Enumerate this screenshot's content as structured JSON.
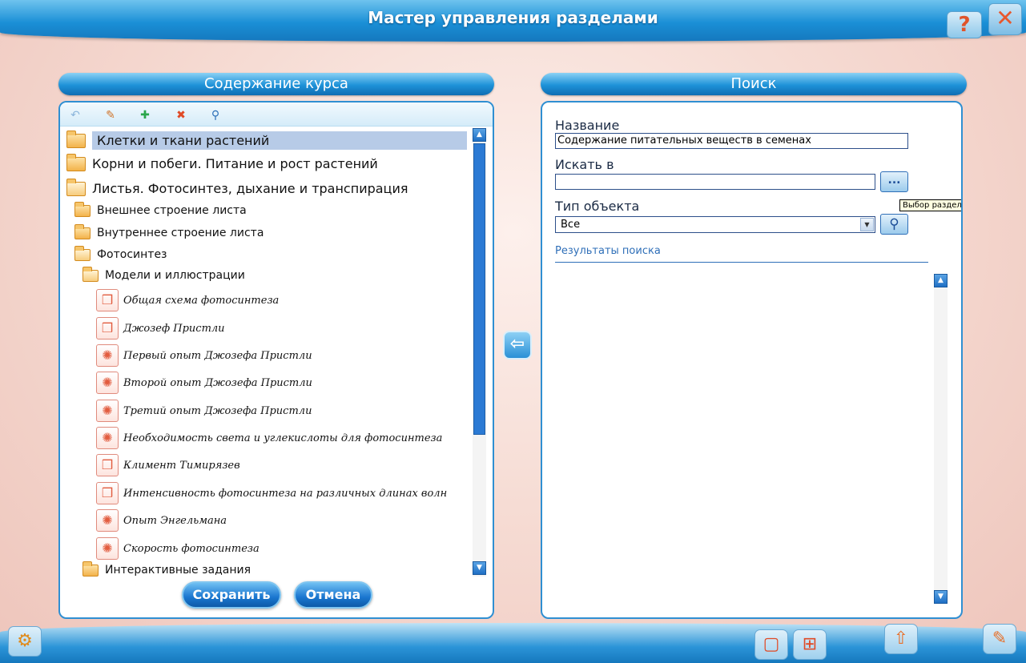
{
  "window": {
    "title": "Мастер управления разделами"
  },
  "left_panel": {
    "heading": "Содержание курса",
    "tree": [
      {
        "label": "Клетки и ткани растений",
        "kind": "folder"
      },
      {
        "label": "Корни и побеги. Питание и рост растений",
        "kind": "folder"
      },
      {
        "label": "Листья. Фотосинтез, дыхание и транспирация",
        "kind": "folder-open"
      },
      {
        "label": "Внешнее строение листа",
        "kind": "folder"
      },
      {
        "label": "Внутреннее строение листа",
        "kind": "folder"
      },
      {
        "label": "Фотосинтез",
        "kind": "folder-open"
      },
      {
        "label": "Модели и иллюстрации",
        "kind": "folder-open"
      },
      {
        "label": "Общая схема фотосинтеза",
        "kind": "model"
      },
      {
        "label": "Джозеф Пристли",
        "kind": "model"
      },
      {
        "label": "Первый опыт Джозефа Пристли",
        "kind": "illustration"
      },
      {
        "label": "Второй опыт Джозефа Пристли",
        "kind": "illustration"
      },
      {
        "label": "Третий опыт Джозефа Пристли",
        "kind": "illustration"
      },
      {
        "label": "Необходимость света и углекислоты для фотосинтеза",
        "kind": "illustration"
      },
      {
        "label": "Климент Тимирязев",
        "kind": "model"
      },
      {
        "label": "Интенсивность фотосинтеза на различных длинах волн",
        "kind": "model"
      },
      {
        "label": "Опыт Энгельмана",
        "kind": "illustration"
      },
      {
        "label": "Скорость фотосинтеза",
        "kind": "illustration"
      },
      {
        "label": "Интерактивные задания",
        "kind": "folder"
      }
    ],
    "save_label": "Сохранить",
    "cancel_label": "Отмена"
  },
  "right_panel": {
    "heading": "Поиск",
    "name_label": "Название",
    "name_value": "Содержание питательных веществ в семенах",
    "search_in_label": "Искать в",
    "search_in_value": "",
    "browse_label": "...",
    "tooltip": "Выбор раздела",
    "type_label": "Тип объекта",
    "type_value": "Все",
    "results_label": "Результаты поиска"
  },
  "icons": [
    "undo-icon",
    "edit-icon",
    "add-icon",
    "delete-icon",
    "find-icon",
    "help-icon",
    "close-icon",
    "settings-icon",
    "window-icon",
    "grid-icon",
    "up-icon",
    "pencil-icon",
    "arrow-left-icon"
  ]
}
